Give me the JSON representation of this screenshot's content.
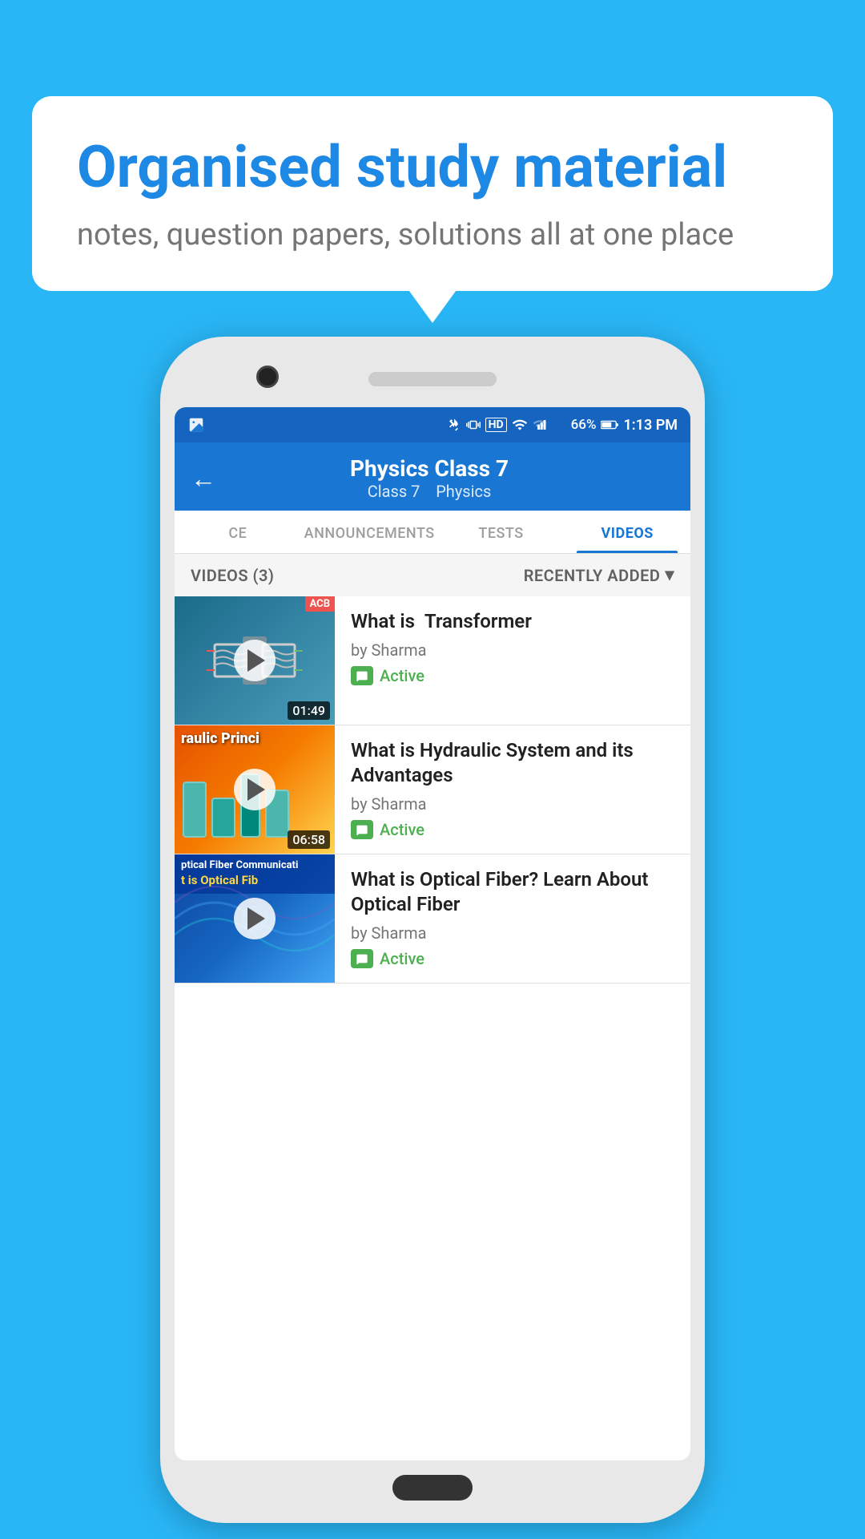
{
  "hero": {
    "title": "Organised study material",
    "subtitle": "notes, question papers, solutions all at one place"
  },
  "appbar": {
    "back_label": "←",
    "title": "Physics Class 7",
    "subtitle_class": "Class 7",
    "subtitle_subject": "Physics"
  },
  "tabs": [
    {
      "id": "ce",
      "label": "CE",
      "active": false
    },
    {
      "id": "announcements",
      "label": "ANNOUNCEMENTS",
      "active": false
    },
    {
      "id": "tests",
      "label": "TESTS",
      "active": false
    },
    {
      "id": "videos",
      "label": "VIDEOS",
      "active": true
    }
  ],
  "filter": {
    "count_label": "VIDEOS (3)",
    "sort_label": "RECENTLY ADDED",
    "sort_icon": "▾"
  },
  "videos": [
    {
      "id": 1,
      "title": "What is  Transformer",
      "author": "by Sharma",
      "status": "Active",
      "duration": "01:49",
      "thumb_type": "transformer",
      "corner_badge": "ACB"
    },
    {
      "id": 2,
      "title": "What is Hydraulic System and its Advantages",
      "author": "by Sharma",
      "status": "Active",
      "duration": "06:58",
      "thumb_type": "hydraulic",
      "thumb_text": "raulic Princi"
    },
    {
      "id": 3,
      "title": "What is Optical Fiber? Learn About Optical Fiber",
      "author": "by Sharma",
      "status": "Active",
      "duration": "",
      "thumb_type": "optical",
      "thumb_text1": "ptical Fiber Communicati",
      "thumb_text2": "t is Optical Fib"
    }
  ],
  "status_bar": {
    "time": "1:13 PM",
    "battery": "66%",
    "signal": "HD"
  }
}
